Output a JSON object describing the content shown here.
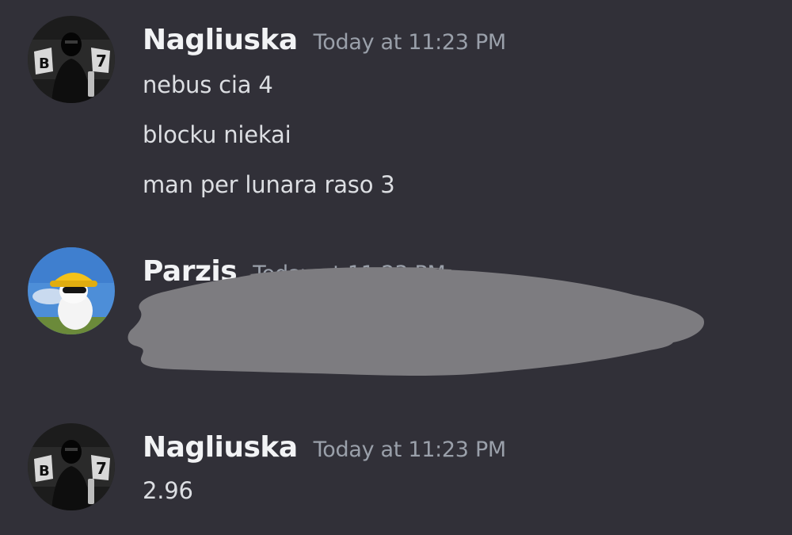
{
  "messages": [
    {
      "username": "Nagliuska",
      "timestamp": "Today at 11:23 PM",
      "avatar_icon": "masked-person-avatar-icon",
      "lines": [
        "nebus cia 4",
        "blocku niekai",
        "man per lunara raso 3"
      ]
    },
    {
      "username": "Parzis",
      "timestamp": "Today at 11:23 PM",
      "avatar_icon": "cat-bucket-hat-avatar-icon",
      "lines": []
    },
    {
      "username": "Nagliuska",
      "timestamp": "Today at 11:23 PM",
      "avatar_icon": "masked-person-avatar-icon",
      "lines": [
        "2.96"
      ]
    }
  ],
  "colors": {
    "background": "#313038",
    "username": "#f2f3f5",
    "timestamp": "#9aa0aa",
    "message_text": "#dcdee2",
    "redaction": "#7d7c80"
  }
}
